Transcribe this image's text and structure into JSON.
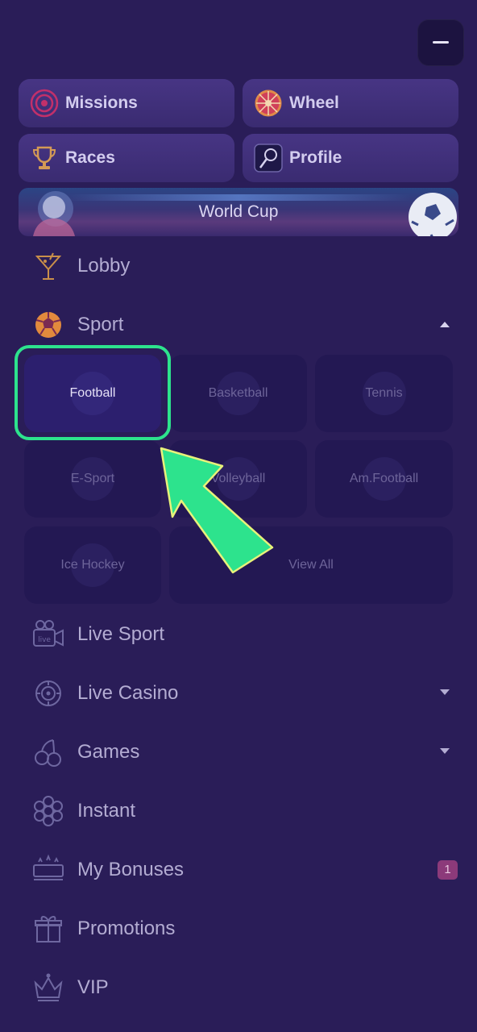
{
  "quick_links": [
    {
      "label": "Missions",
      "icon": "target-icon"
    },
    {
      "label": "Wheel",
      "icon": "wheel-icon"
    },
    {
      "label": "Races",
      "icon": "trophy-icon"
    },
    {
      "label": "Profile",
      "icon": "profile-icon"
    }
  ],
  "banner": {
    "label": "World Cup"
  },
  "menu": {
    "lobby": "Lobby",
    "sport": "Sport",
    "live_sport": "Live Sport",
    "live_casino": "Live Casino",
    "games": "Games",
    "instant": "Instant",
    "my_bonuses": "My Bonuses",
    "my_bonuses_badge": "1",
    "promotions": "Promotions",
    "vip": "VIP"
  },
  "sport_tiles": [
    {
      "label": "Football"
    },
    {
      "label": "Basketball"
    },
    {
      "label": "Tennis"
    },
    {
      "label": "E-Sport"
    },
    {
      "label": "Volleyball"
    },
    {
      "label": "Am.Football"
    },
    {
      "label": "Ice Hockey"
    },
    {
      "label": "View All"
    }
  ],
  "colors": {
    "accent": "#2de38d",
    "background": "#2a1d58"
  }
}
